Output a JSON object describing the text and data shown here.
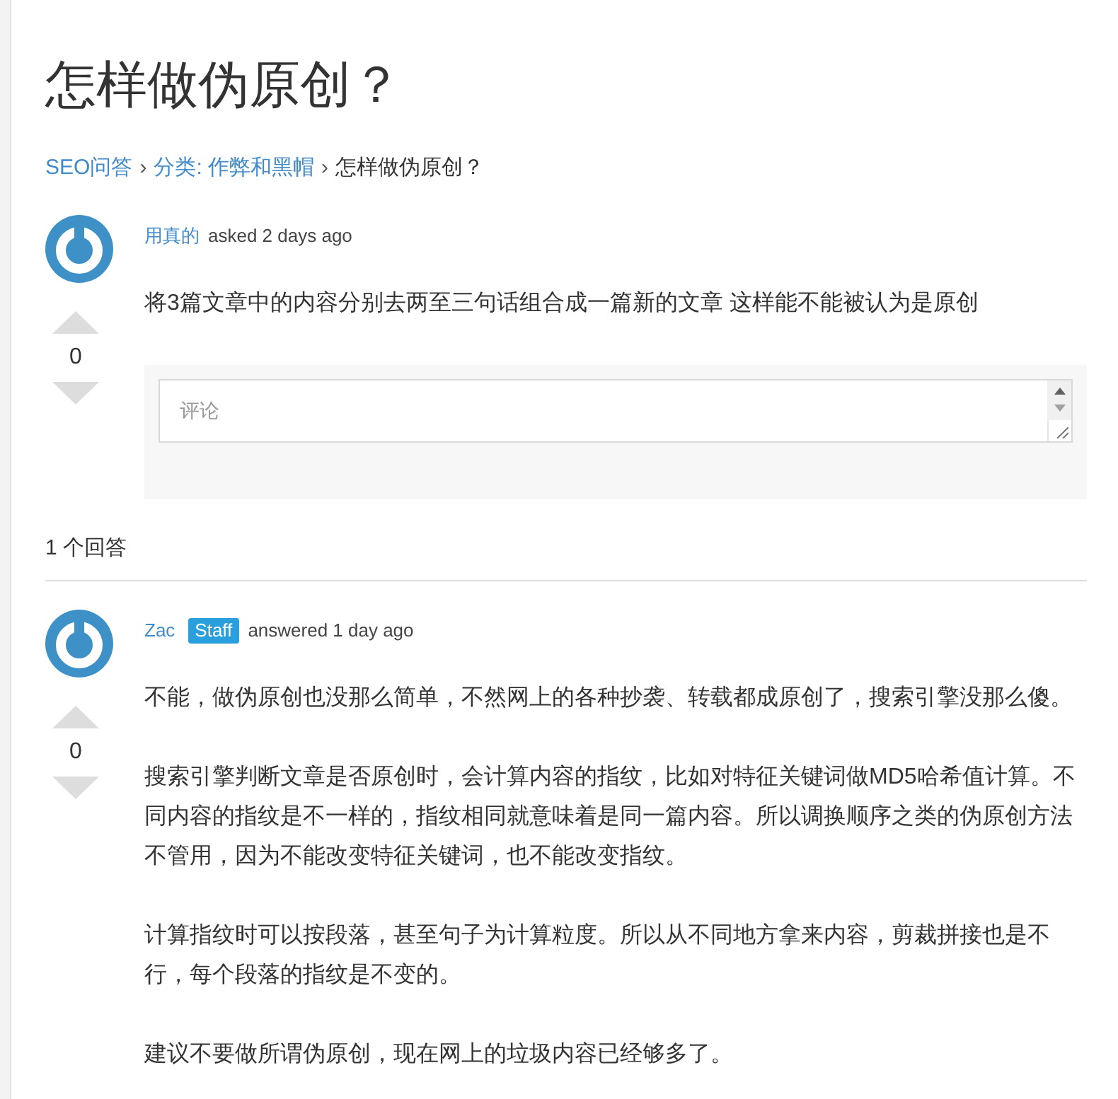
{
  "page": {
    "title": "怎样做伪原创？"
  },
  "breadcrumb": [
    {
      "kind": "link",
      "label": "SEO问答"
    },
    {
      "kind": "separator",
      "label": "›"
    },
    {
      "kind": "link",
      "label": "分类: 作弊和黑帽"
    },
    {
      "kind": "separator",
      "label": "›"
    },
    {
      "kind": "current",
      "label": "怎样做伪原创？"
    }
  ],
  "question": {
    "author": "用真的",
    "action": "asked 2 days ago",
    "votes": "0",
    "body": "将3篇文章中的内容分别去两至三句话组合成一篇新的文章 这样能不能被认为是原创",
    "comment": {
      "placeholder": "评论"
    }
  },
  "answers_heading": "1 个回答",
  "answers": [
    {
      "author": "Zac",
      "badge": "Staff",
      "action": "answered 1 day ago",
      "votes": "0",
      "paragraphs": [
        "不能，做伪原创也没那么简单，不然网上的各种抄袭、转载都成原创了，搜索引擎没那么傻。",
        "搜索引擎判断文章是否原创时，会计算内容的指纹，比如对特征关键词做MD5哈希值计算。不同内容的指纹是不一样的，指纹相同就意味着是同一篇内容。所以调换顺序之类的伪原创方法不管用，因为不能改变特征关键词，也不能改变指纹。",
        "计算指纹时可以按段落，甚至句子为计算粒度。所以从不同地方拿来内容，剪裁拼接也是不行，每个段落的指纹是不变的。",
        "建议不要做所谓伪原创，现在网上的垃圾内容已经够多了。"
      ]
    }
  ]
}
